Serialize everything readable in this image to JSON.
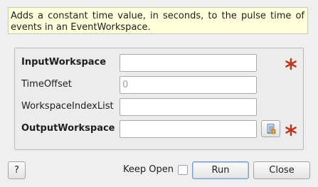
{
  "description": "Adds a constant time value, in seconds, to the pulse time of events in an EventWorkspace.",
  "properties": [
    {
      "label": "InputWorkspace",
      "value": "",
      "placeholder": "",
      "mandatory": true
    },
    {
      "label": "TimeOffset",
      "value": "",
      "placeholder": "0",
      "mandatory": false
    },
    {
      "label": "WorkspaceIndexList",
      "value": "",
      "placeholder": "",
      "mandatory": false
    },
    {
      "label": "OutputWorkspace",
      "value": "",
      "placeholder": "",
      "mandatory": true
    }
  ],
  "footer": {
    "help_label": "?",
    "keep_open_label": "Keep Open",
    "keep_open_checked": false,
    "run_label": "Run",
    "close_label": "Close"
  },
  "icons": {
    "mandatory": "mandatory-star-icon",
    "browse": "workspace-browse-icon"
  },
  "colors": {
    "description_bg": "#ffffdc",
    "mandatory_star": "#b8391f",
    "window_bg": "#efefef"
  }
}
